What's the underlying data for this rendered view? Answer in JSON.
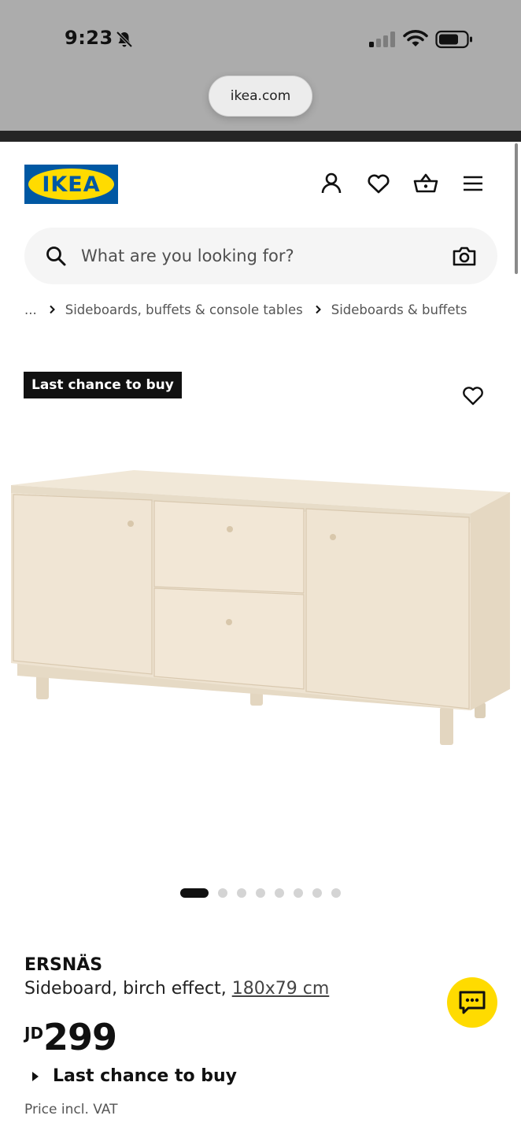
{
  "status_bar": {
    "time": "9:23",
    "icons": [
      "bell-slash-icon",
      "cellular-signal-icon",
      "wifi-icon",
      "battery-icon"
    ]
  },
  "browser": {
    "url": "ikea.com"
  },
  "header": {
    "logo_text": "IKEA",
    "icons": [
      "profile-icon",
      "heart-icon",
      "shopping-basket-icon",
      "menu-icon"
    ]
  },
  "search": {
    "placeholder": "What are you looking for?"
  },
  "breadcrumb": {
    "ellipsis": "...",
    "items": [
      "Sideboards, buffets & console tables",
      "Sideboards & buffets"
    ]
  },
  "product": {
    "badge": "Last chance to buy",
    "name": "ERSNÄS",
    "description": "Sideboard, birch effect,",
    "dimensions": "180x79 cm",
    "currency": "JD",
    "price": "299",
    "availability_label": "Last chance to buy",
    "price_note": "Price incl. VAT"
  },
  "gallery": {
    "total_images": 8,
    "active_index": 0
  },
  "colors": {
    "ikea_blue": "#0058a3",
    "ikea_yellow": "#ffdb00",
    "text": "#111111",
    "chrome_gray": "#acacac"
  }
}
